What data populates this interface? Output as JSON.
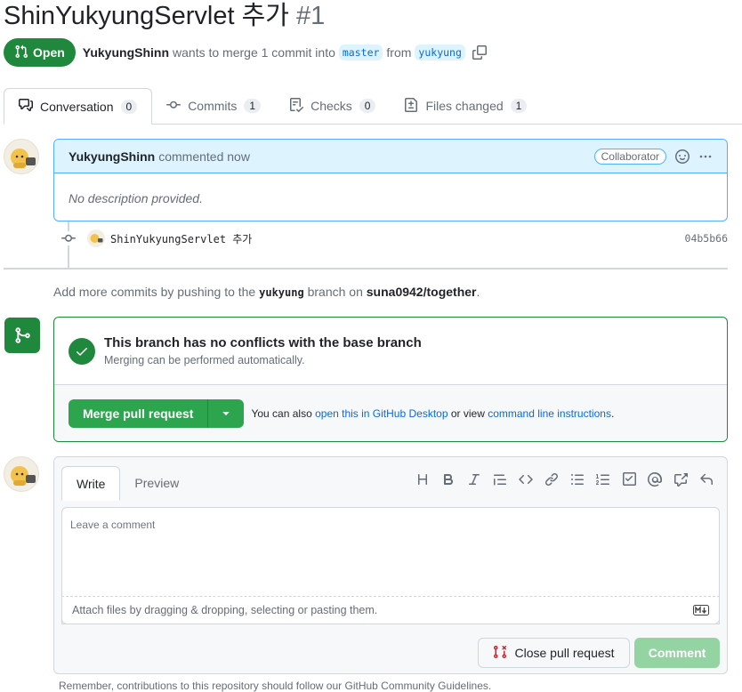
{
  "pr": {
    "title": "ShinYukyungServlet 추가",
    "number": "#1",
    "state": "Open",
    "author": "YukyungShinn",
    "wants_text": "wants to merge 1 commit into",
    "base_branch": "master",
    "from_text": "from",
    "head_branch": "yukyung"
  },
  "tabs": [
    {
      "label": "Conversation",
      "count": "0",
      "icon": "conversation-icon"
    },
    {
      "label": "Commits",
      "count": "1",
      "icon": "commit-icon"
    },
    {
      "label": "Checks",
      "count": "0",
      "icon": "checks-icon"
    },
    {
      "label": "Files changed",
      "count": "1",
      "icon": "file-diff-icon"
    }
  ],
  "comment": {
    "author": "YukyungShinn",
    "meta": "commented now",
    "role": "Collaborator",
    "body": "No description provided."
  },
  "commit": {
    "message": "ShinYukyungServlet 추가",
    "sha": "04b5b66"
  },
  "add_commits": {
    "prefix": "Add more commits by pushing to the",
    "branch": "yukyung",
    "middle": "branch on",
    "repo": "suna0942/together",
    "suffix": "."
  },
  "merge": {
    "title": "This branch has no conflicts with the base branch",
    "subtitle": "Merging can be performed automatically.",
    "button": "Merge pull request",
    "also_text": "You can also",
    "desktop_link": "open this in GitHub Desktop",
    "or_text": "or view",
    "cli_link": "command line instructions",
    "end": "."
  },
  "editor": {
    "tab_write": "Write",
    "tab_preview": "Preview",
    "placeholder": "Leave a comment",
    "attach_text": "Attach files by dragging & dropping, selecting or pasting them.",
    "close_button": "Close pull request",
    "comment_button": "Comment"
  },
  "footer": {
    "note": "Remember, contributions to this repository should follow our GitHub Community Guidelines."
  },
  "colors": {
    "green": "#1f883d",
    "blue": "#0969da",
    "red": "#cf222e"
  }
}
